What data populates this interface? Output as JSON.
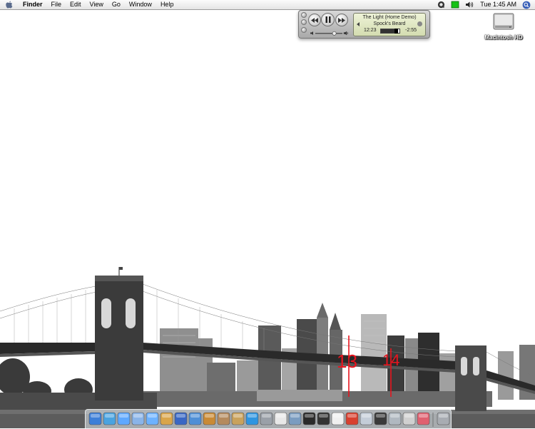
{
  "menubar": {
    "apple_icon": "apple-icon",
    "app_name": "Finder",
    "menus": [
      "File",
      "Edit",
      "View",
      "Go",
      "Window",
      "Help"
    ],
    "clock": "Tue 1:45 AM",
    "extras_icons": [
      "quicktime-icon",
      "battery-icon",
      "volume-icon"
    ],
    "spotlight_icon": "spotlight-icon"
  },
  "itunes": {
    "song_title": "The Light (Home Demo)",
    "artist": "Spock's Beard",
    "time_elapsed": "12:23",
    "time_remaining": "-2:55",
    "progress_fraction": 0.81,
    "volume_fraction": 0.7
  },
  "desktop": {
    "drive_label": "Macintosh HD",
    "drive_icon": "hard-drive-icon",
    "annotations": [
      "13",
      "14"
    ],
    "annotation_color": "#e8141e"
  },
  "dock": {
    "items": [
      {
        "icon": "finder-icon",
        "color": "#3d7fd8"
      },
      {
        "icon": "safari-icon",
        "color": "#4aa3e0"
      },
      {
        "icon": "ichat-icon",
        "color": "#5ea8ff"
      },
      {
        "icon": "preview-icon",
        "color": "#8ab4e8"
      },
      {
        "icon": "itunes-icon",
        "color": "#6db2ff"
      },
      {
        "icon": "iphoto-icon",
        "color": "#d9a54a"
      },
      {
        "icon": "imovie-icon",
        "color": "#3a67c4"
      },
      {
        "icon": "idvd-icon",
        "color": "#4f8fd6"
      },
      {
        "icon": "garageband-icon",
        "color": "#c98a35"
      },
      {
        "icon": "mail-icon",
        "color": "#b48a5e"
      },
      {
        "icon": "address-book-icon",
        "color": "#c9a25c"
      },
      {
        "icon": "quicktime-dock-icon",
        "color": "#2f95e0"
      },
      {
        "icon": "system-prefs-icon",
        "color": "#9aa0a8"
      },
      {
        "icon": "textedit-icon",
        "color": "#e8e8e8"
      },
      {
        "icon": "sherlock-icon",
        "color": "#7a9cc0"
      },
      {
        "icon": "terminal-icon",
        "color": "#2a2a2a"
      },
      {
        "icon": "clapper-icon",
        "color": "#333333"
      },
      {
        "icon": "ipod-icon",
        "color": "#f0f0f0"
      },
      {
        "icon": "toolbox-icon",
        "color": "#d8402f"
      },
      {
        "icon": "monitor-icon",
        "color": "#c4cdd8"
      },
      {
        "icon": "terminal-2-icon",
        "color": "#3a3a3a"
      },
      {
        "icon": "printer-icon",
        "color": "#b0b8c0"
      },
      {
        "icon": "apple-logo-icon",
        "color": "#d0d0d0"
      },
      {
        "icon": "test-tube-icon",
        "color": "#e06070"
      },
      {
        "icon": "trash-icon",
        "color": "#a8acb2"
      }
    ]
  }
}
